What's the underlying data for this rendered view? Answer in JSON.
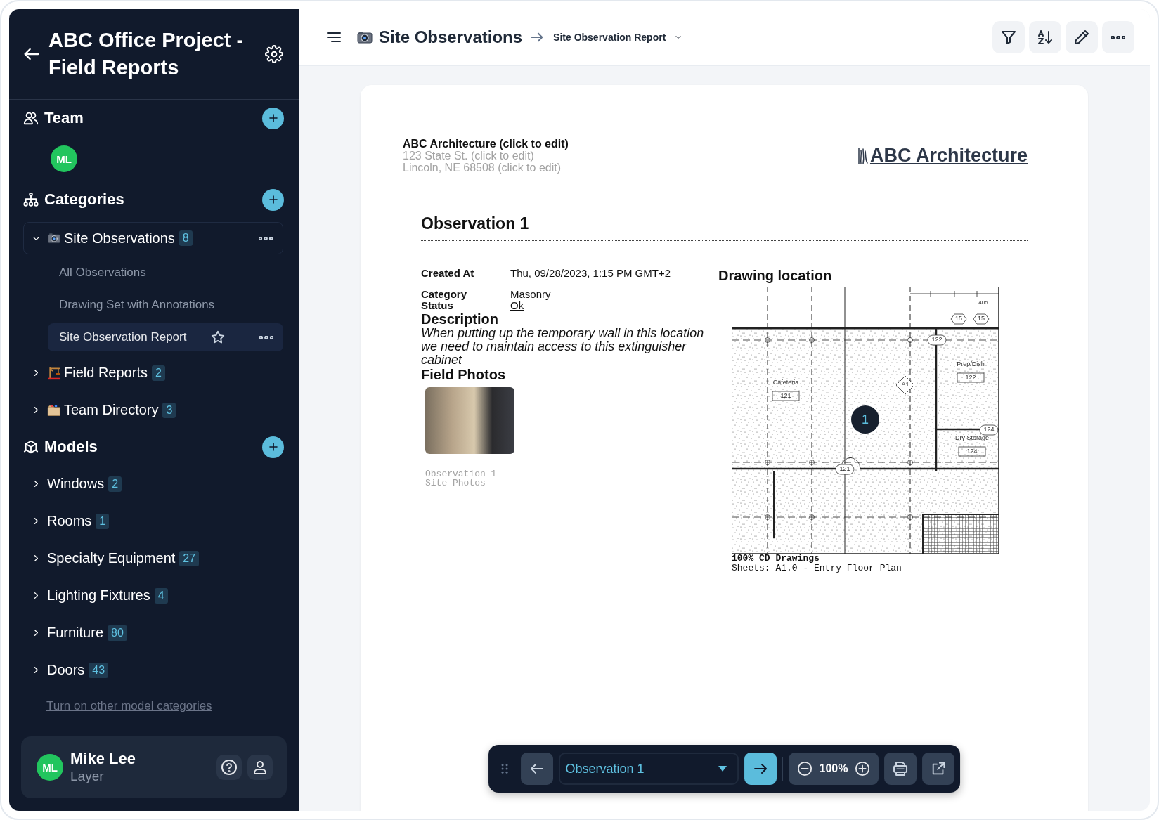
{
  "sidebar": {
    "title": "ABC Office Project - Field Reports",
    "team": {
      "title": "Team",
      "members": [
        {
          "initials": "ML"
        }
      ]
    },
    "categories": {
      "title": "Categories",
      "items": [
        {
          "label": "Site Observations",
          "count": "8",
          "expanded": true,
          "children": [
            {
              "label": "All Observations",
              "selected": false
            },
            {
              "label": "Drawing Set with Annotations",
              "selected": false
            },
            {
              "label": "Site Observation Report",
              "selected": true
            }
          ]
        },
        {
          "label": "Field Reports",
          "count": "2",
          "expanded": false
        },
        {
          "label": "Team Directory",
          "count": "3",
          "expanded": false
        }
      ]
    },
    "models": {
      "title": "Models",
      "items": [
        {
          "label": "Windows",
          "count": "2",
          "expanded": false
        },
        {
          "label": "Rooms",
          "count": "1",
          "expanded": false
        },
        {
          "label": "Specialty Equipment",
          "count": "27",
          "expanded": false
        },
        {
          "label": "Lighting Fixtures",
          "count": "4",
          "expanded": false
        },
        {
          "label": "Furniture",
          "count": "80",
          "expanded": false
        },
        {
          "label": "Doors",
          "count": "43",
          "expanded": false
        }
      ],
      "link": "Turn on other model categories"
    },
    "user": {
      "initials": "ML",
      "name": "Mike Lee",
      "role": "Layer"
    }
  },
  "header": {
    "title": "Site Observations",
    "view": "Site Observation Report"
  },
  "report": {
    "company": {
      "name": "ABC Architecture (click to edit)",
      "address_lines": [
        "123 State St. (click to edit)",
        "Lincoln, NE 68508 (click to edit)"
      ]
    },
    "logo": "ABC Architecture",
    "title": "Observation 1",
    "fields": [
      {
        "label": "Created At",
        "value": "Thu, 09/28/2023, 1:15 PM GMT+2",
        "kind": "text"
      },
      {
        "label": "Category",
        "value": "Masonry",
        "kind": "text"
      },
      {
        "label": "Status",
        "value": "Ok",
        "kind": "link"
      }
    ],
    "description": {
      "label": "Description",
      "text": "When putting up the temporary wall in this location we need to maintain access to this extinguisher cabinet"
    },
    "photos": {
      "label": "Field Photos",
      "caption_lines": [
        "Observation 1",
        "Site Photos"
      ]
    },
    "drawing": {
      "title": "Drawing location",
      "pin": "1",
      "rooms": [
        {
          "name": "Cafeteria",
          "number": "121"
        },
        {
          "name": "Prep/Dish",
          "number": "122"
        },
        {
          "name": "Dry Storage",
          "number": "124"
        }
      ],
      "door_tags": [
        "122",
        "121",
        "124"
      ],
      "grid_marker": "A1",
      "wall_tags": [
        "15",
        "15"
      ],
      "dimension": "405",
      "caption": "100% CD Drawings",
      "sheet": "Sheets: A1.0 - Entry Floor Plan"
    }
  },
  "toolbar": {
    "current": "Observation 1",
    "zoom": "100%"
  }
}
